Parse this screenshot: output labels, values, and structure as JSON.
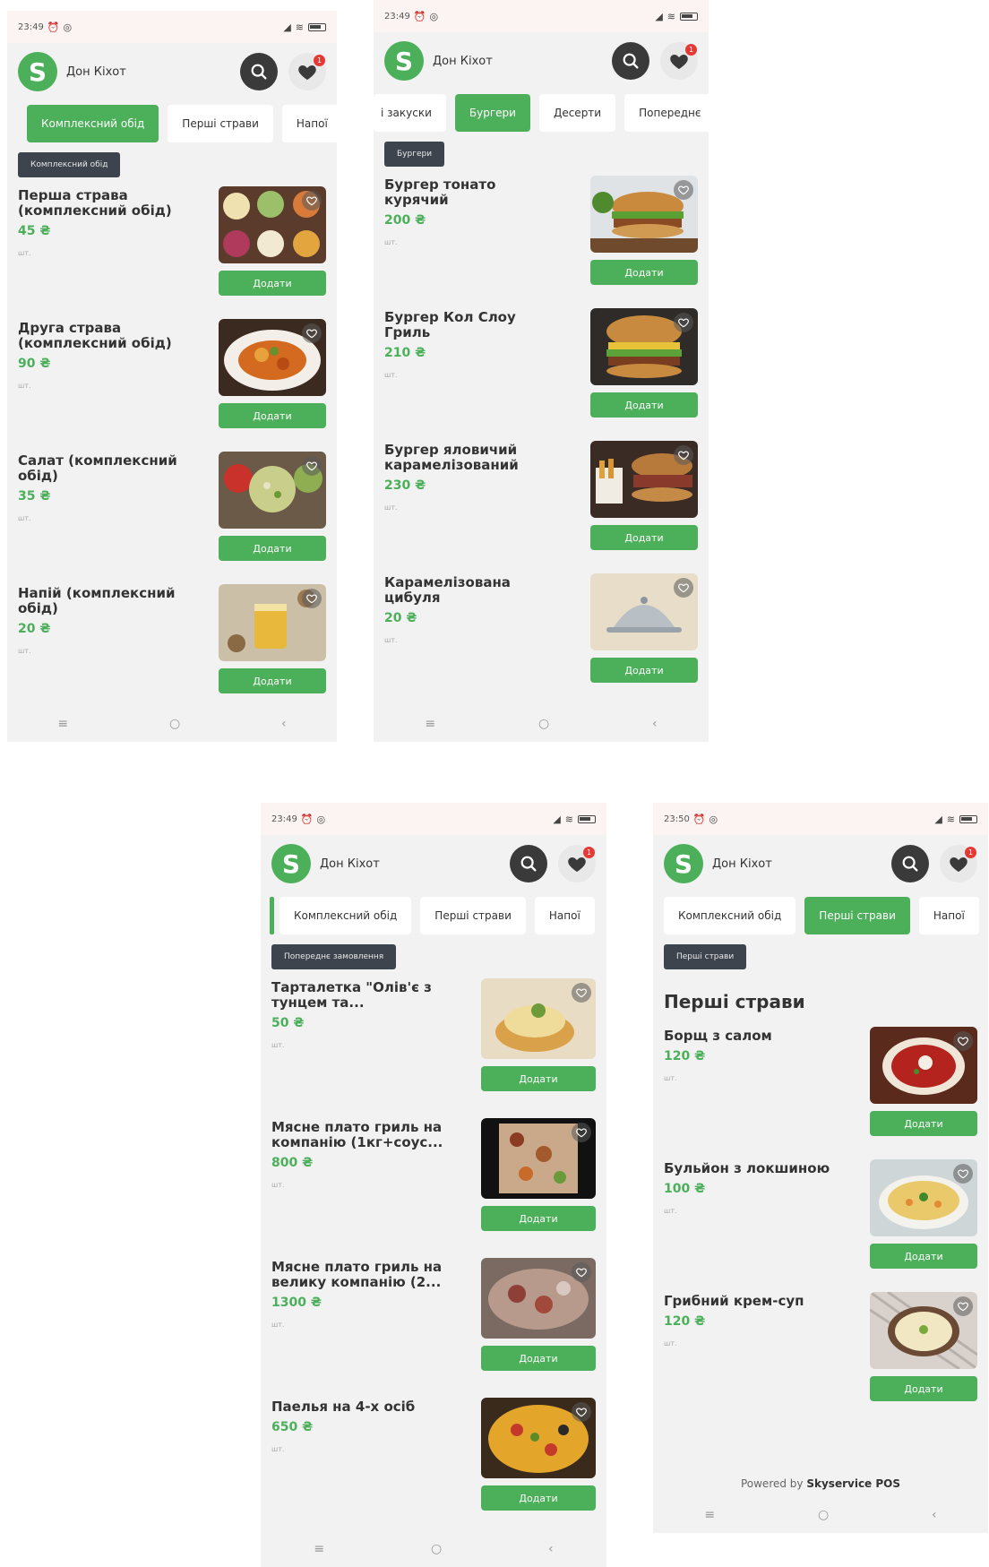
{
  "app": {
    "shop_name": "Дон Кіхот",
    "logo_letter": "S",
    "favorites_count": "1",
    "add_label": "Додати",
    "unit_label": "шт.",
    "accent_color": "#4caf5a",
    "nav_menu": "≡",
    "nav_home": "○",
    "nav_back": "‹"
  },
  "screens": [
    {
      "time": "23:49",
      "tabs": [
        {
          "label": "Комплексний обід"
        },
        {
          "label": "Перші страви"
        },
        {
          "label": "Напої"
        }
      ],
      "chip": "Комплексний обід",
      "items": [
        {
          "name": "Перша страва (комплексний обід)",
          "price": "45 ₴"
        },
        {
          "name": "Друга страва (комплексний обід)",
          "price": "90 ₴"
        },
        {
          "name": "Салат (комплексний обід)",
          "price": "35 ₴"
        },
        {
          "name": "Напій (комплексний обід)",
          "price": "20 ₴"
        }
      ]
    },
    {
      "time": "23:49",
      "tabs": [
        {
          "label": "і закуски"
        },
        {
          "label": "Бургери"
        },
        {
          "label": "Десерти"
        },
        {
          "label": "Попереднє"
        }
      ],
      "chip": "Бургери",
      "items": [
        {
          "name": "Бургер тонато курячий",
          "price": "200 ₴"
        },
        {
          "name": "Бургер Кол Слоу Гриль",
          "price": "210 ₴"
        },
        {
          "name": "Бургер яловичий карамелізований",
          "price": "230 ₴"
        },
        {
          "name": "Карамелізована цибуля",
          "price": "20 ₴"
        }
      ]
    },
    {
      "time": "23:49",
      "tabs": [
        {
          "label": "Комплексний обід"
        },
        {
          "label": "Перші страви"
        },
        {
          "label": "Напої"
        }
      ],
      "chip": "Попереднє замовлення",
      "items": [
        {
          "name": "Тарталетка \"Олів'є з тунцем та...",
          "price": "50 ₴"
        },
        {
          "name": "Мясне плато гриль на компанію (1кг+соус...",
          "price": "800 ₴"
        },
        {
          "name": "Мясне плато гриль на велику компанію (2...",
          "price": "1300 ₴"
        },
        {
          "name": "Паелья на 4-х осіб",
          "price": "650 ₴"
        }
      ]
    },
    {
      "time": "23:50",
      "tabs": [
        {
          "label": "Комплексний обід"
        },
        {
          "label": "Перші страви"
        },
        {
          "label": "Напої"
        }
      ],
      "chip": "Перші страви",
      "section_title": "Перші страви",
      "items": [
        {
          "name": "Борщ з салом",
          "price": "120 ₴"
        },
        {
          "name": "Бульйон з локшиною",
          "price": "100 ₴"
        },
        {
          "name": "Грибний крем-суп",
          "price": "120 ₴"
        }
      ],
      "powered_prefix": "Powered by",
      "powered_brand": "Skyservice POS"
    }
  ]
}
